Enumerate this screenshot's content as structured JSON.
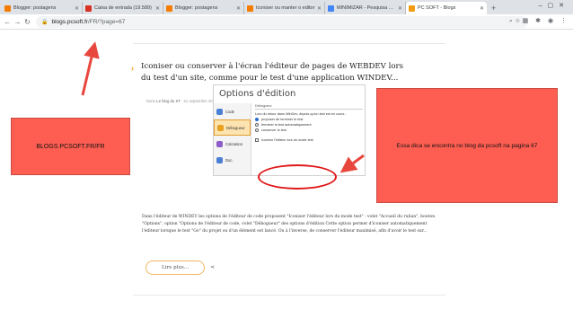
{
  "tabs": [
    {
      "label": "Blogger: postagens",
      "color": "#f57c00"
    },
    {
      "label": "Caixa de entrada (19.589)",
      "color": "#d93025"
    },
    {
      "label": "Blogger: postagens",
      "color": "#f57c00"
    },
    {
      "label": "Iconiser ou manter o editor",
      "color": "#f57c00"
    },
    {
      "label": "MINIMIZAR - Pesquisa Goo",
      "color": "#4285f4"
    },
    {
      "label": "PC SOFT - Blogs",
      "color": "#f39c12"
    }
  ],
  "toolbar": {
    "back_icon": "arrow-left-icon",
    "forward_icon": "arrow-right-icon",
    "reload_icon": "reload-icon",
    "url_host": "blogs.pcsoft.fr",
    "url_path": "/FR/?page=67"
  },
  "post": {
    "title": "Iconiser ou conserver à l'écran l'éditeur de pages de WEBDEV lors du test d'un site, comme pour le test d'une application WINDEV...",
    "meta_prefix": "Dans",
    "meta_category": "Le blog du ST",
    "meta_date": "21 septembre 2006",
    "meta_comments": "2 commentaires",
    "meta_author_prefix": "posté par",
    "meta_author": "Guillaume BATLE",
    "excerpt": "Dans l'éditeur de WINDEV les options de l'éditeur de code proposent \"Iconiser l'éditeur lors du mode test\" - volet \"Accueil du ruban\", bouton \"Options\", option \"Options de l'éditeur de code, volet \"Débogueur\" des options d'édition Cette option permet d'iconiser automatiquement l'éditeur lorsque le test \"Go\" du projet ou d'un élément est lancé. Ou à l'inverse, de conserver l'éditeur maximisé, afin d'avoir le test sur...",
    "read_more": "Lire plus..."
  },
  "screenshot": {
    "title": "Options d'édition",
    "side_items": [
      {
        "label": "Code",
        "color": "#4a7fd4"
      },
      {
        "label": "Débogueur",
        "color": "#e8a020"
      },
      {
        "label": "Coloration",
        "color": "#8c5cc8"
      },
      {
        "label": "Doc.",
        "color": "#4a7fd4"
      }
    ],
    "group_label": "Débogueur",
    "question": "Lors du retour dans WinDev, depuis qu'un test est en cours :",
    "options": [
      "proposer de terminer le test",
      "terminer le test automatiquement",
      "conserver le test"
    ],
    "checkbox_label": "Iconiser l'éditeur lors du mode test"
  },
  "notes": {
    "left": "BLOGS.PCSOFT.FR/FR",
    "right": "Essa dica se encontra no blog da pcsoft na pagina 67"
  }
}
